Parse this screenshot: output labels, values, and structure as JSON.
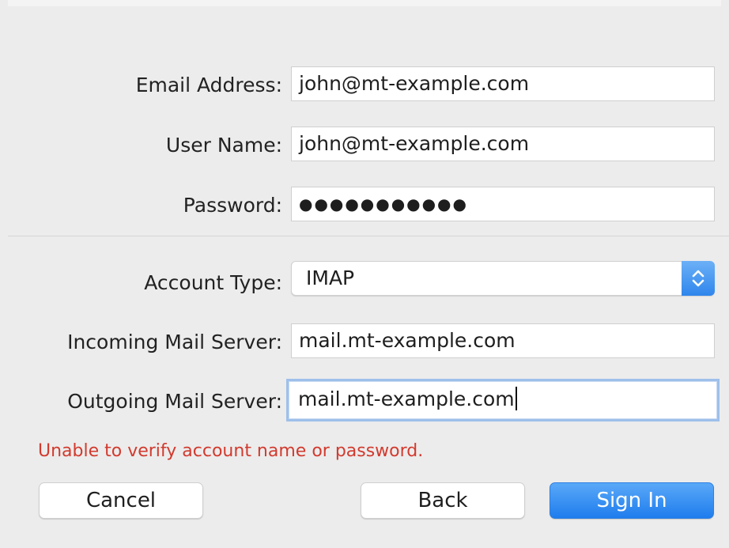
{
  "form": {
    "email_label": "Email Address:",
    "email_value": "john@mt-example.com",
    "username_label": "User Name:",
    "username_value": "john@mt-example.com",
    "password_label": "Password:",
    "password_value": "●●●●●●●●●●●",
    "account_type_label": "Account Type:",
    "account_type_value": "IMAP",
    "incoming_label": "Incoming Mail Server:",
    "incoming_value": "mail.mt-example.com",
    "outgoing_label": "Outgoing Mail Server:",
    "outgoing_value": "mail.mt-example.com"
  },
  "error_message": "Unable to verify account name or password.",
  "buttons": {
    "cancel": "Cancel",
    "back": "Back",
    "sign_in": "Sign In"
  },
  "colors": {
    "error": "#d23a2e",
    "accent": "#2f86ec",
    "focus_ring": "#9ec0ea",
    "background": "#ececec"
  },
  "icons": {
    "select_stepper": "up-down-chevron-icon"
  }
}
